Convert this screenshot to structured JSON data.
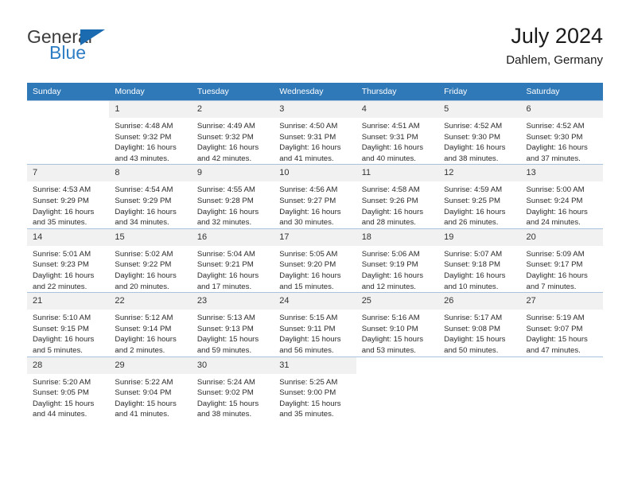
{
  "brand": {
    "name_part1": "General",
    "name_part2": "Blue",
    "flag_icon": "blue-triangle-flag-icon"
  },
  "header": {
    "month_year": "July 2024",
    "location": "Dahlem, Germany"
  },
  "colors": {
    "header_blue": "#3079b8",
    "brand_blue": "#2d7dc4",
    "daynum_band": "#f1f1f1",
    "grid_border": "#a9c3de"
  },
  "calendar": {
    "weekday_headers": [
      "Sunday",
      "Monday",
      "Tuesday",
      "Wednesday",
      "Thursday",
      "Friday",
      "Saturday"
    ],
    "weeks": [
      [
        {
          "day": "",
          "lines": []
        },
        {
          "day": "1",
          "lines": [
            "Sunrise: 4:48 AM",
            "Sunset: 9:32 PM",
            "Daylight: 16 hours",
            "and 43 minutes."
          ]
        },
        {
          "day": "2",
          "lines": [
            "Sunrise: 4:49 AM",
            "Sunset: 9:32 PM",
            "Daylight: 16 hours",
            "and 42 minutes."
          ]
        },
        {
          "day": "3",
          "lines": [
            "Sunrise: 4:50 AM",
            "Sunset: 9:31 PM",
            "Daylight: 16 hours",
            "and 41 minutes."
          ]
        },
        {
          "day": "4",
          "lines": [
            "Sunrise: 4:51 AM",
            "Sunset: 9:31 PM",
            "Daylight: 16 hours",
            "and 40 minutes."
          ]
        },
        {
          "day": "5",
          "lines": [
            "Sunrise: 4:52 AM",
            "Sunset: 9:30 PM",
            "Daylight: 16 hours",
            "and 38 minutes."
          ]
        },
        {
          "day": "6",
          "lines": [
            "Sunrise: 4:52 AM",
            "Sunset: 9:30 PM",
            "Daylight: 16 hours",
            "and 37 minutes."
          ]
        }
      ],
      [
        {
          "day": "7",
          "lines": [
            "Sunrise: 4:53 AM",
            "Sunset: 9:29 PM",
            "Daylight: 16 hours",
            "and 35 minutes."
          ]
        },
        {
          "day": "8",
          "lines": [
            "Sunrise: 4:54 AM",
            "Sunset: 9:29 PM",
            "Daylight: 16 hours",
            "and 34 minutes."
          ]
        },
        {
          "day": "9",
          "lines": [
            "Sunrise: 4:55 AM",
            "Sunset: 9:28 PM",
            "Daylight: 16 hours",
            "and 32 minutes."
          ]
        },
        {
          "day": "10",
          "lines": [
            "Sunrise: 4:56 AM",
            "Sunset: 9:27 PM",
            "Daylight: 16 hours",
            "and 30 minutes."
          ]
        },
        {
          "day": "11",
          "lines": [
            "Sunrise: 4:58 AM",
            "Sunset: 9:26 PM",
            "Daylight: 16 hours",
            "and 28 minutes."
          ]
        },
        {
          "day": "12",
          "lines": [
            "Sunrise: 4:59 AM",
            "Sunset: 9:25 PM",
            "Daylight: 16 hours",
            "and 26 minutes."
          ]
        },
        {
          "day": "13",
          "lines": [
            "Sunrise: 5:00 AM",
            "Sunset: 9:24 PM",
            "Daylight: 16 hours",
            "and 24 minutes."
          ]
        }
      ],
      [
        {
          "day": "14",
          "lines": [
            "Sunrise: 5:01 AM",
            "Sunset: 9:23 PM",
            "Daylight: 16 hours",
            "and 22 minutes."
          ]
        },
        {
          "day": "15",
          "lines": [
            "Sunrise: 5:02 AM",
            "Sunset: 9:22 PM",
            "Daylight: 16 hours",
            "and 20 minutes."
          ]
        },
        {
          "day": "16",
          "lines": [
            "Sunrise: 5:04 AM",
            "Sunset: 9:21 PM",
            "Daylight: 16 hours",
            "and 17 minutes."
          ]
        },
        {
          "day": "17",
          "lines": [
            "Sunrise: 5:05 AM",
            "Sunset: 9:20 PM",
            "Daylight: 16 hours",
            "and 15 minutes."
          ]
        },
        {
          "day": "18",
          "lines": [
            "Sunrise: 5:06 AM",
            "Sunset: 9:19 PM",
            "Daylight: 16 hours",
            "and 12 minutes."
          ]
        },
        {
          "day": "19",
          "lines": [
            "Sunrise: 5:07 AM",
            "Sunset: 9:18 PM",
            "Daylight: 16 hours",
            "and 10 minutes."
          ]
        },
        {
          "day": "20",
          "lines": [
            "Sunrise: 5:09 AM",
            "Sunset: 9:17 PM",
            "Daylight: 16 hours",
            "and 7 minutes."
          ]
        }
      ],
      [
        {
          "day": "21",
          "lines": [
            "Sunrise: 5:10 AM",
            "Sunset: 9:15 PM",
            "Daylight: 16 hours",
            "and 5 minutes."
          ]
        },
        {
          "day": "22",
          "lines": [
            "Sunrise: 5:12 AM",
            "Sunset: 9:14 PM",
            "Daylight: 16 hours",
            "and 2 minutes."
          ]
        },
        {
          "day": "23",
          "lines": [
            "Sunrise: 5:13 AM",
            "Sunset: 9:13 PM",
            "Daylight: 15 hours",
            "and 59 minutes."
          ]
        },
        {
          "day": "24",
          "lines": [
            "Sunrise: 5:15 AM",
            "Sunset: 9:11 PM",
            "Daylight: 15 hours",
            "and 56 minutes."
          ]
        },
        {
          "day": "25",
          "lines": [
            "Sunrise: 5:16 AM",
            "Sunset: 9:10 PM",
            "Daylight: 15 hours",
            "and 53 minutes."
          ]
        },
        {
          "day": "26",
          "lines": [
            "Sunrise: 5:17 AM",
            "Sunset: 9:08 PM",
            "Daylight: 15 hours",
            "and 50 minutes."
          ]
        },
        {
          "day": "27",
          "lines": [
            "Sunrise: 5:19 AM",
            "Sunset: 9:07 PM",
            "Daylight: 15 hours",
            "and 47 minutes."
          ]
        }
      ],
      [
        {
          "day": "28",
          "lines": [
            "Sunrise: 5:20 AM",
            "Sunset: 9:05 PM",
            "Daylight: 15 hours",
            "and 44 minutes."
          ]
        },
        {
          "day": "29",
          "lines": [
            "Sunrise: 5:22 AM",
            "Sunset: 9:04 PM",
            "Daylight: 15 hours",
            "and 41 minutes."
          ]
        },
        {
          "day": "30",
          "lines": [
            "Sunrise: 5:24 AM",
            "Sunset: 9:02 PM",
            "Daylight: 15 hours",
            "and 38 minutes."
          ]
        },
        {
          "day": "31",
          "lines": [
            "Sunrise: 5:25 AM",
            "Sunset: 9:00 PM",
            "Daylight: 15 hours",
            "and 35 minutes."
          ]
        },
        {
          "day": "",
          "lines": []
        },
        {
          "day": "",
          "lines": []
        },
        {
          "day": "",
          "lines": []
        }
      ]
    ]
  }
}
